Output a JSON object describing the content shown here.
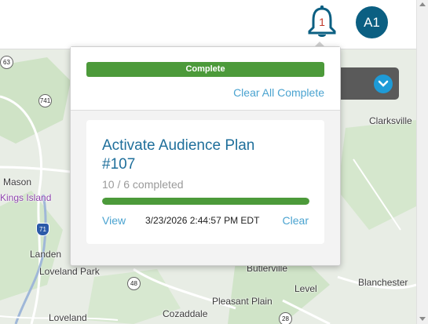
{
  "header": {
    "notification_count": "1",
    "avatar_initials": "A1",
    "colors": {
      "avatar": "#0b5f82",
      "bell": "#0b5f82",
      "badge": "#c0392b"
    }
  },
  "map": {
    "places": [
      "Clarksville",
      "Mason",
      "Kings Island",
      "Landen",
      "Loveland Park",
      "Butlerville",
      "Level",
      "Blanchester",
      "Pleasant Plain",
      "Cozaddale",
      "Loveland"
    ],
    "routes": [
      "63",
      "741",
      "71",
      "48",
      "28"
    ]
  },
  "notifications": {
    "complete_label": "Complete",
    "clear_all_label": "Clear All Complete",
    "items": [
      {
        "title": "Activate Audience Plan #107",
        "progress_text": "10 / 6 completed",
        "progress": 1.0,
        "view_label": "View",
        "timestamp": "3/23/2026 2:44:57 PM EDT",
        "clear_label": "Clear"
      }
    ],
    "colors": {
      "complete": "#4c9a3a",
      "link": "#4aa3d0",
      "title": "#1f6f9b"
    }
  }
}
